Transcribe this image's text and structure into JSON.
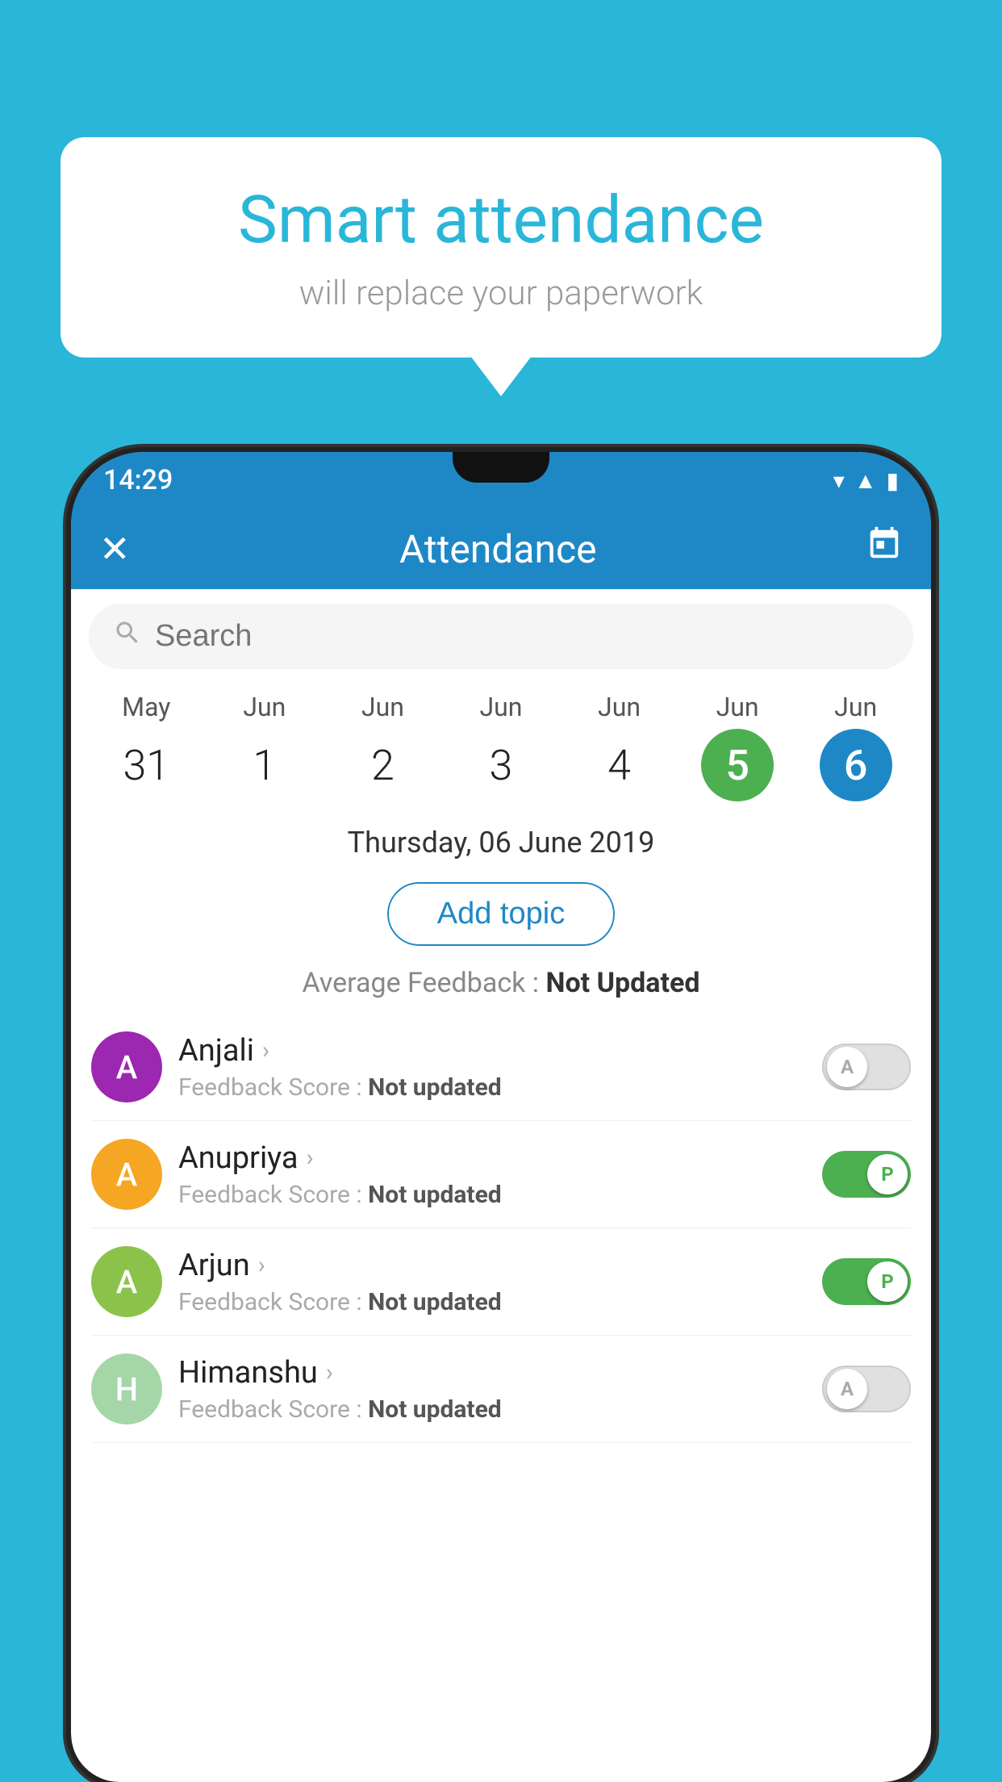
{
  "background": {
    "color": "#29b6d9"
  },
  "bubble": {
    "title": "Smart attendance",
    "subtitle": "will replace your paperwork"
  },
  "statusBar": {
    "time": "14:29",
    "icons": [
      "wifi",
      "signal",
      "battery"
    ]
  },
  "appBar": {
    "title": "Attendance",
    "closeIcon": "✕",
    "calendarIcon": "📅"
  },
  "search": {
    "placeholder": "Search"
  },
  "dates": [
    {
      "month": "May",
      "day": "31",
      "selected": false
    },
    {
      "month": "Jun",
      "day": "1",
      "selected": false
    },
    {
      "month": "Jun",
      "day": "2",
      "selected": false
    },
    {
      "month": "Jun",
      "day": "3",
      "selected": false
    },
    {
      "month": "Jun",
      "day": "4",
      "selected": false
    },
    {
      "month": "Jun",
      "day": "5",
      "selected": "green"
    },
    {
      "month": "Jun",
      "day": "6",
      "selected": "blue"
    }
  ],
  "selectedDateText": "Thursday, 06 June 2019",
  "addTopicLabel": "Add topic",
  "avgFeedbackLabel": "Average Feedback : ",
  "avgFeedbackValue": "Not Updated",
  "students": [
    {
      "name": "Anjali",
      "avatarColor": "#9c27b0",
      "avatarLetter": "A",
      "feedbackLabel": "Feedback Score : ",
      "feedbackValue": "Not updated",
      "toggleOn": false,
      "toggleLetter": "A"
    },
    {
      "name": "Anupriya",
      "avatarColor": "#f5a623",
      "avatarLetter": "A",
      "feedbackLabel": "Feedback Score : ",
      "feedbackValue": "Not updated",
      "toggleOn": true,
      "toggleLetter": "P"
    },
    {
      "name": "Arjun",
      "avatarColor": "#8bc34a",
      "avatarLetter": "A",
      "feedbackLabel": "Feedback Score : ",
      "feedbackValue": "Not updated",
      "toggleOn": true,
      "toggleLetter": "P"
    },
    {
      "name": "Himanshu",
      "avatarColor": "#a5d6a7",
      "avatarLetter": "H",
      "feedbackLabel": "Feedback Score : ",
      "feedbackValue": "Not updated",
      "toggleOn": false,
      "toggleLetter": "A"
    }
  ]
}
